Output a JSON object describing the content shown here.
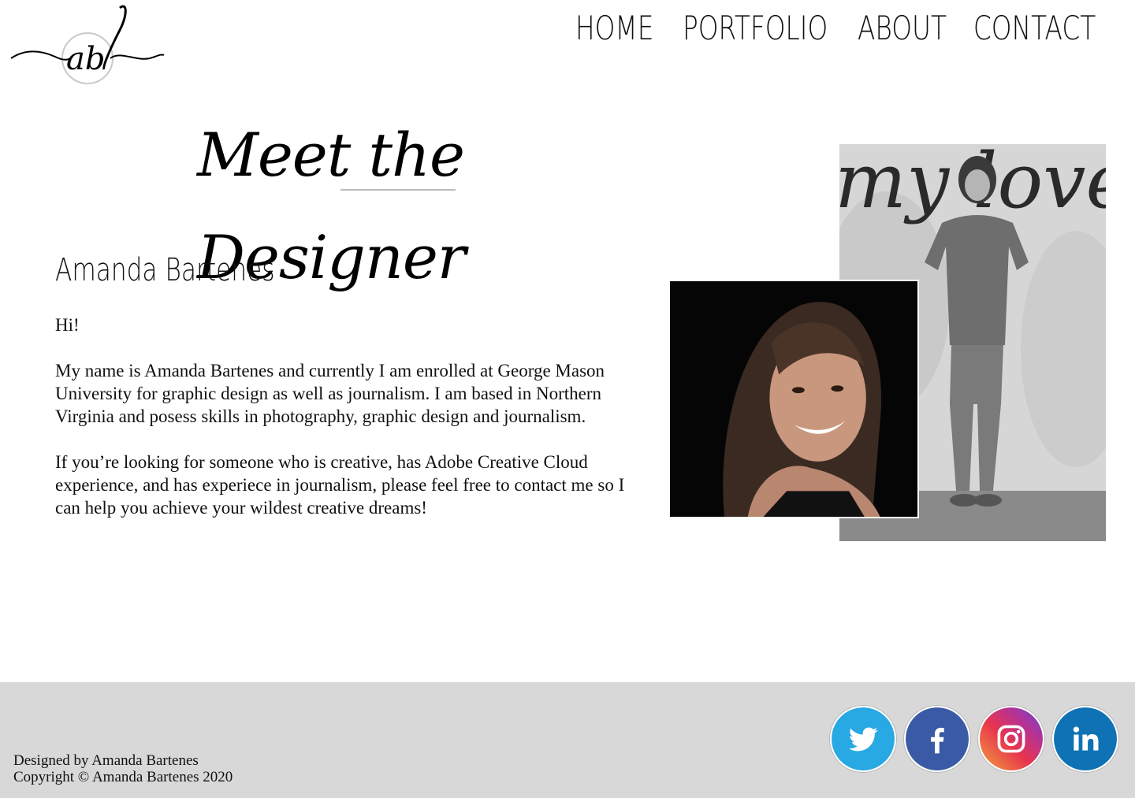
{
  "logo": {
    "monogram": "ab"
  },
  "nav": {
    "items": [
      "HOME",
      "PORTFOLIO",
      "ABOUT",
      "CONTACT"
    ]
  },
  "heading": "Meet the Designer",
  "name": "Amanda Bartenes",
  "bio": {
    "greeting": "Hi!",
    "paragraph1": "My name is Amanda Bartenes and currently I am enrolled at George Mason University for graphic design as well as journalism. I am based in Northern Virginia and posess skills in photography, graphic design and journalism.",
    "paragraph2": "If you’re looking for someone who is creative, has Adobe Creative Cloud experience, and has experiece in journalism, please feel free to contact me so I can help you achieve your wildest creative dreams!"
  },
  "photos": {
    "full_body_mural_text": "my love"
  },
  "footer": {
    "designed_by": "Designed by Amanda Bartenes",
    "copyright": "Copyright © Amanda Bartenes 2020"
  },
  "socials": [
    {
      "name": "twitter-icon",
      "color": "#28a9e3"
    },
    {
      "name": "facebook-icon",
      "color": "#3b5aa5"
    },
    {
      "name": "instagram-icon",
      "color": "#e8344e"
    },
    {
      "name": "linkedin-icon",
      "color": "#0e72b5"
    }
  ]
}
